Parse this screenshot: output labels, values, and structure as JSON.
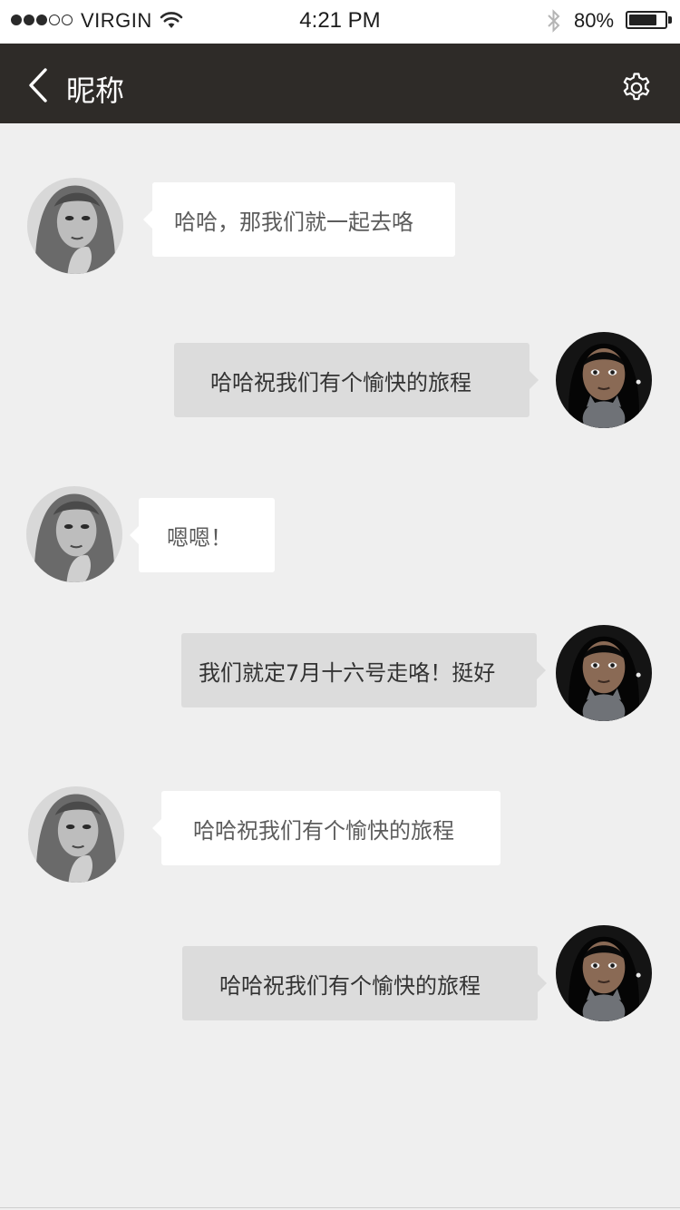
{
  "status_bar": {
    "signal_bars": 5,
    "signal_filled": 3,
    "carrier": "VIRGIN",
    "time": "4:21 PM",
    "battery_percent_text": "80%",
    "battery_level": 0.8,
    "icons": [
      "wifi-icon",
      "bluetooth-icon",
      "battery-icon"
    ]
  },
  "nav": {
    "title": "昵称",
    "back_icon": "chevron-left-icon",
    "settings_icon": "gear-icon"
  },
  "colors": {
    "nav_background": "#2e2b28",
    "chat_background": "#efefef",
    "incoming_bubble": "#ffffff",
    "outgoing_bubble": "#dcdcdc"
  },
  "messages": [
    {
      "side": "left",
      "text": "哈哈，那我们就一起去咯",
      "avatar": "contact-avatar"
    },
    {
      "side": "right",
      "text": "哈哈祝我们有个愉快的旅程",
      "avatar": "user-avatar"
    },
    {
      "side": "left",
      "text": "嗯嗯！",
      "avatar": "contact-avatar"
    },
    {
      "side": "right",
      "text": "我们就定7月十六号走咯！挺好",
      "avatar": "user-avatar"
    },
    {
      "side": "left",
      "text": "哈哈祝我们有个愉快的旅程",
      "avatar": "contact-avatar"
    },
    {
      "side": "right",
      "text": "哈哈祝我们有个愉快的旅程",
      "avatar": "user-avatar"
    }
  ]
}
